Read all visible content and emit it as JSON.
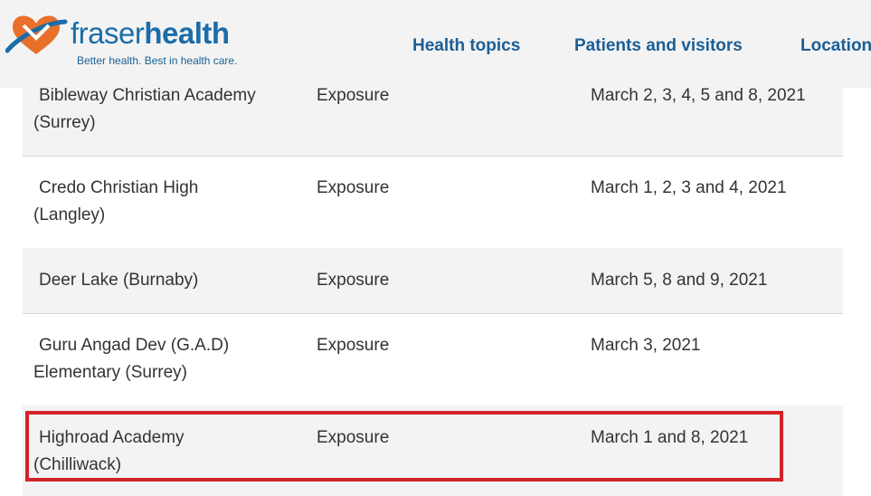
{
  "header": {
    "brand_light": "fraser",
    "brand_bold": "health",
    "tagline": "Better health. Best in health care.",
    "nav": [
      {
        "label": "Health topics"
      },
      {
        "label": "Patients and visitors"
      },
      {
        "label": "Locations"
      }
    ],
    "colors": {
      "brand_blue": "#1a6da8",
      "logo_orange": "#e8702a",
      "logo_red": "#d2232a"
    }
  },
  "table": {
    "rows": [
      {
        "name_line1": "Bibleway Christian Academy",
        "name_line2": "(Surrey)",
        "type": "Exposure",
        "dates": "March 2, 3, 4, 5 and 8, 2021"
      },
      {
        "name_line1": "Credo Christian High",
        "name_line2": "(Langley)",
        "type": "Exposure",
        "dates": "March 1, 2, 3 and 4, 2021"
      },
      {
        "name_line1": "Deer Lake (Burnaby)",
        "name_line2": "",
        "type": "Exposure",
        "dates": "March 5, 8 and 9, 2021"
      },
      {
        "name_line1": "Guru Angad Dev (G.A.D)",
        "name_line2": "Elementary (Surrey)",
        "type": "Exposure",
        "dates": "March 3, 2021"
      },
      {
        "name_line1": "Highroad Academy",
        "name_line2": "(Chilliwack)",
        "type": "Exposure",
        "dates": "March 1 and 8, 2021"
      }
    ],
    "highlight_color": "#d2232a"
  }
}
